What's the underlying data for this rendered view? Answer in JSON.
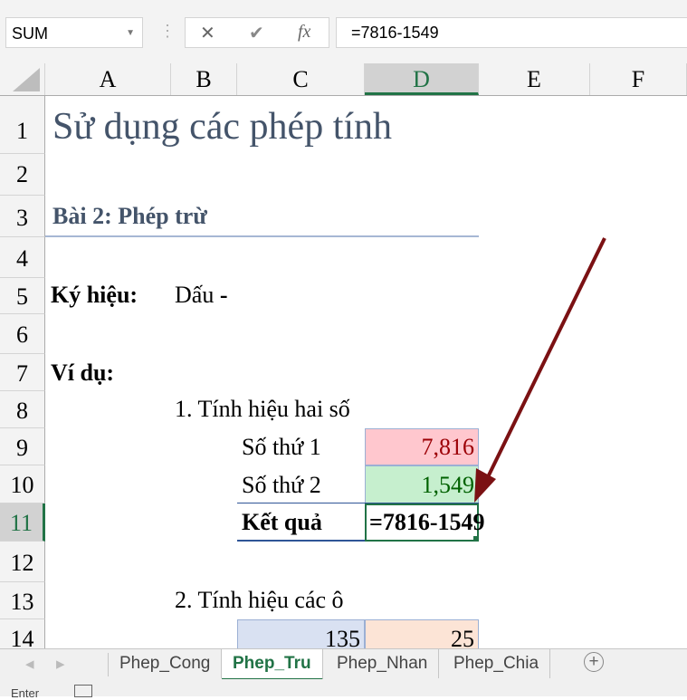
{
  "formula_bar": {
    "name_box": "SUM",
    "cancel_icon": "✕",
    "enter_icon": "✔",
    "fx_label": "fx",
    "formula": "=7816-1549"
  },
  "columns": [
    "A",
    "B",
    "C",
    "D",
    "E",
    "F"
  ],
  "rows": [
    "1",
    "2",
    "3",
    "4",
    "5",
    "6",
    "7",
    "8",
    "9",
    "10",
    "11",
    "12",
    "13",
    "14"
  ],
  "cells": {
    "title": "Sử dụng các phép tính",
    "subtitle": "Bài 2: Phép trừ",
    "symbol_label": "Ký hiệu:",
    "symbol_value": "Dấu",
    "symbol_sign": "-",
    "example_label": "Ví dụ:",
    "ex1": "1. Tính hiệu hai số",
    "num1_label": "Số thứ 1",
    "num1": "7,816",
    "num2_label": "Số thứ 2",
    "num2": "1,549",
    "result_label": "Kết quả",
    "result_edit": "=7816-1549",
    "ex2": "2. Tính hiệu các ô",
    "c14": "135",
    "d14": "25"
  },
  "sheet_tabs": [
    "Phep_Cong",
    "Phep_Tru",
    "Phep_Nhan",
    "Phep_Chia"
  ],
  "active_tab": "Phep_Tru",
  "status": {
    "mode": "Enter"
  },
  "colors": {
    "accent": "#217346",
    "arrow": "#7b1113",
    "pink": "#ffc7ce",
    "green": "#c6efce",
    "blue": "#d9e1f2",
    "peach": "#fce4d6"
  }
}
